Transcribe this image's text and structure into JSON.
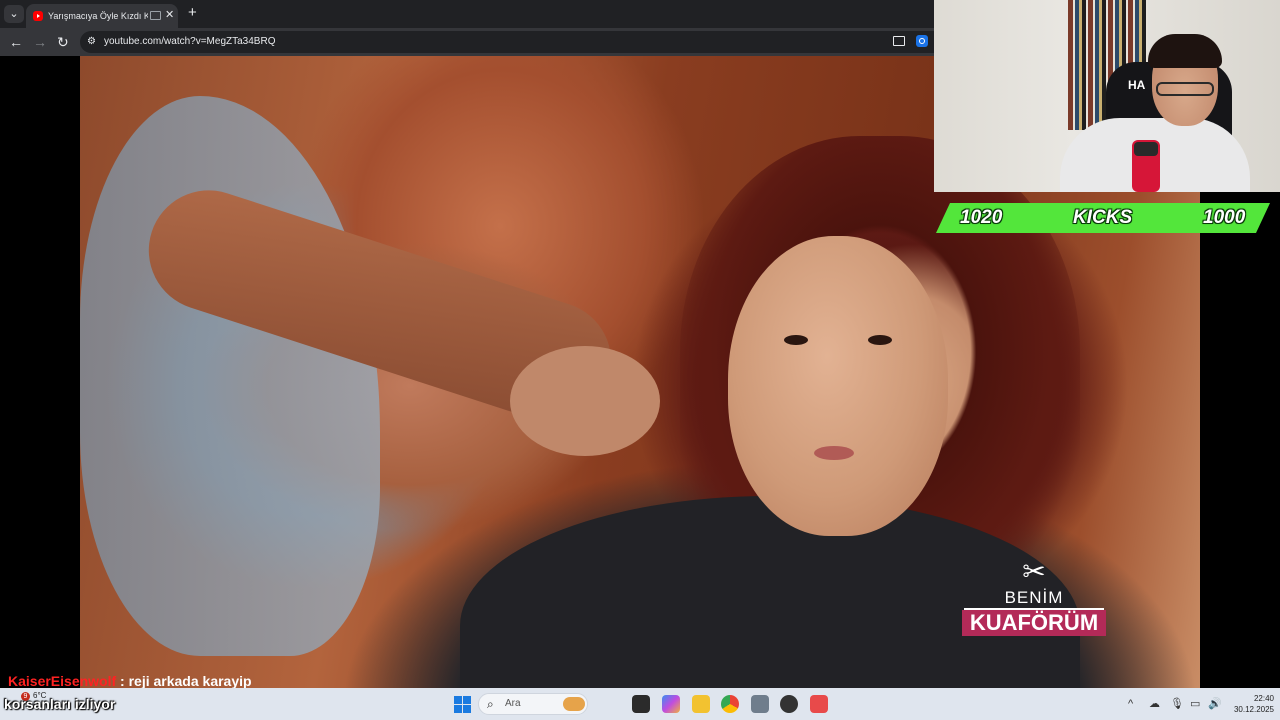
{
  "browser": {
    "tab_title": "Yarışmacıya Öyle Kızdı Ki D",
    "tab_menu_icon": "chevron-down-icon",
    "new_tab_label": "+",
    "close_label": "✕",
    "url": "youtube.com/watch?v=MegZTa34BRQ",
    "nav": {
      "back": "←",
      "forward": "→",
      "reload": "↻"
    }
  },
  "video": {
    "logo_line1": "BENİM",
    "logo_line2": "KUAFÖRÜM"
  },
  "stream_overlay": {
    "kicks_left": "1020",
    "kicks_label": "KICKS",
    "kicks_right": "1000",
    "kicks_color": "#53e63b",
    "chair_brand": "HA",
    "chat_user": "KaiserEisenwolf",
    "chat_message": " : reji arkada karayip",
    "chat_user_color": "#ff2222",
    "bottom_text": "korsanları izliyor"
  },
  "taskbar": {
    "weather_badge": "9",
    "weather_temp": "6°C",
    "search_placeholder": "Ara",
    "tray_chevron": "^",
    "time": "22:40",
    "date": "30.12.2025"
  }
}
